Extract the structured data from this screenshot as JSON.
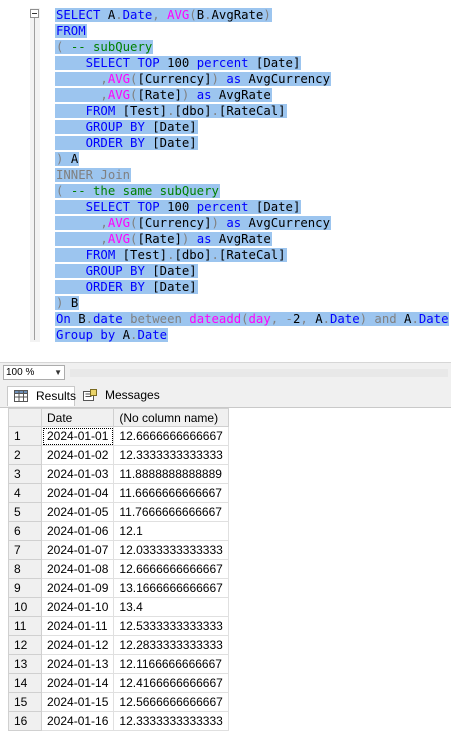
{
  "editor": {
    "lines": [
      [
        [
          "kw",
          "SELECT "
        ],
        [
          "bk",
          "A"
        ],
        [
          "gr",
          "."
        ],
        [
          "kw",
          "Date"
        ],
        [
          "gr",
          ", "
        ],
        [
          "fn",
          "AVG"
        ],
        [
          "gr",
          "("
        ],
        [
          "bk",
          "B"
        ],
        [
          "gr",
          "."
        ],
        [
          "bk",
          "AvgRate"
        ],
        [
          "gr",
          ")"
        ]
      ],
      [
        [
          "kw",
          "FROM"
        ]
      ],
      [
        [
          "gr",
          "( "
        ],
        [
          "cm",
          "-- subQuery"
        ]
      ],
      [
        [
          "bk",
          "    "
        ],
        [
          "kw",
          "SELECT TOP "
        ],
        [
          "bk",
          "100 "
        ],
        [
          "kw",
          "percent "
        ],
        [
          "bk",
          "[Date]"
        ]
      ],
      [
        [
          "bk",
          "      "
        ],
        [
          "gr",
          ","
        ],
        [
          "fn",
          "AVG"
        ],
        [
          "gr",
          "("
        ],
        [
          "bk",
          "[Currency]"
        ],
        [
          "gr",
          ") "
        ],
        [
          "kw",
          "as "
        ],
        [
          "bk",
          "AvgCurrency"
        ]
      ],
      [
        [
          "bk",
          "      "
        ],
        [
          "gr",
          ","
        ],
        [
          "fn",
          "AVG"
        ],
        [
          "gr",
          "("
        ],
        [
          "bk",
          "[Rate]"
        ],
        [
          "gr",
          ") "
        ],
        [
          "kw",
          "as "
        ],
        [
          "bk",
          "AvgRate"
        ]
      ],
      [
        [
          "bk",
          "    "
        ],
        [
          "kw",
          "FROM "
        ],
        [
          "bk",
          "[Test]"
        ],
        [
          "gr",
          "."
        ],
        [
          "bk",
          "[dbo]"
        ],
        [
          "gr",
          "."
        ],
        [
          "bk",
          "[RateCal]"
        ]
      ],
      [
        [
          "bk",
          "    "
        ],
        [
          "kw",
          "GROUP BY "
        ],
        [
          "bk",
          "[Date]"
        ]
      ],
      [
        [
          "bk",
          "    "
        ],
        [
          "kw",
          "ORDER BY "
        ],
        [
          "bk",
          "[Date]"
        ]
      ],
      [
        [
          "gr",
          ") "
        ],
        [
          "bk",
          "A"
        ]
      ],
      [
        [
          "gr",
          "INNER Join"
        ]
      ],
      [
        [
          "gr",
          "( "
        ],
        [
          "cm",
          "-- the same subQuery"
        ]
      ],
      [
        [
          "bk",
          "    "
        ],
        [
          "kw",
          "SELECT TOP "
        ],
        [
          "bk",
          "100 "
        ],
        [
          "kw",
          "percent "
        ],
        [
          "bk",
          "[Date]"
        ]
      ],
      [
        [
          "bk",
          "      "
        ],
        [
          "gr",
          ","
        ],
        [
          "fn",
          "AVG"
        ],
        [
          "gr",
          "("
        ],
        [
          "bk",
          "[Currency]"
        ],
        [
          "gr",
          ") "
        ],
        [
          "kw",
          "as "
        ],
        [
          "bk",
          "AvgCurrency"
        ]
      ],
      [
        [
          "bk",
          "      "
        ],
        [
          "gr",
          ","
        ],
        [
          "fn",
          "AVG"
        ],
        [
          "gr",
          "("
        ],
        [
          "bk",
          "[Rate]"
        ],
        [
          "gr",
          ") "
        ],
        [
          "kw",
          "as "
        ],
        [
          "bk",
          "AvgRate"
        ]
      ],
      [
        [
          "bk",
          "    "
        ],
        [
          "kw",
          "FROM "
        ],
        [
          "bk",
          "[Test]"
        ],
        [
          "gr",
          "."
        ],
        [
          "bk",
          "[dbo]"
        ],
        [
          "gr",
          "."
        ],
        [
          "bk",
          "[RateCal]"
        ]
      ],
      [
        [
          "bk",
          "    "
        ],
        [
          "kw",
          "GROUP BY "
        ],
        [
          "bk",
          "[Date]"
        ]
      ],
      [
        [
          "bk",
          "    "
        ],
        [
          "kw",
          "ORDER BY "
        ],
        [
          "bk",
          "[Date]"
        ]
      ],
      [
        [
          "gr",
          ") "
        ],
        [
          "bk",
          "B"
        ]
      ],
      [
        [
          "kw",
          "On "
        ],
        [
          "bk",
          "B"
        ],
        [
          "gr",
          "."
        ],
        [
          "kw",
          "date "
        ],
        [
          "gr",
          "between "
        ],
        [
          "fn",
          "dateadd"
        ],
        [
          "gr",
          "("
        ],
        [
          "fn",
          "day"
        ],
        [
          "gr",
          ", -"
        ],
        [
          "bk",
          "2"
        ],
        [
          "gr",
          ", "
        ],
        [
          "bk",
          "A"
        ],
        [
          "gr",
          "."
        ],
        [
          "kw",
          "Date"
        ],
        [
          "gr",
          ") and "
        ],
        [
          "bk",
          "A"
        ],
        [
          "gr",
          "."
        ],
        [
          "kw",
          "Date"
        ]
      ],
      [
        [
          "kw",
          "Group by "
        ],
        [
          "bk",
          "A"
        ],
        [
          "gr",
          "."
        ],
        [
          "kw",
          "Date"
        ]
      ]
    ]
  },
  "zoom": {
    "value": "100 %"
  },
  "tabs": {
    "results": "Results",
    "messages": "Messages"
  },
  "grid": {
    "columns": [
      "Date",
      "(No column name)"
    ],
    "rows": [
      [
        "1",
        "2024-01-01",
        "12.6666666666667"
      ],
      [
        "2",
        "2024-01-02",
        "12.3333333333333"
      ],
      [
        "3",
        "2024-01-03",
        "11.8888888888889"
      ],
      [
        "4",
        "2024-01-04",
        "11.6666666666667"
      ],
      [
        "5",
        "2024-01-05",
        "11.7666666666667"
      ],
      [
        "6",
        "2024-01-06",
        "12.1"
      ],
      [
        "7",
        "2024-01-07",
        "12.0333333333333"
      ],
      [
        "8",
        "2024-01-08",
        "12.6666666666667"
      ],
      [
        "9",
        "2024-01-09",
        "13.1666666666667"
      ],
      [
        "10",
        "2024-01-10",
        "13.4"
      ],
      [
        "11",
        "2024-01-11",
        "12.5333333333333"
      ],
      [
        "12",
        "2024-01-12",
        "12.2833333333333"
      ],
      [
        "13",
        "2024-01-13",
        "12.1166666666667"
      ],
      [
        "14",
        "2024-01-14",
        "12.4166666666667"
      ],
      [
        "15",
        "2024-01-15",
        "12.5666666666667"
      ],
      [
        "16",
        "2024-01-16",
        "12.3333333333333"
      ]
    ]
  },
  "colors": {
    "selection": "#9cc5ef",
    "keyword": "#0000ff",
    "function": "#ff00ff",
    "comment": "#008000",
    "operator": "#808080"
  }
}
